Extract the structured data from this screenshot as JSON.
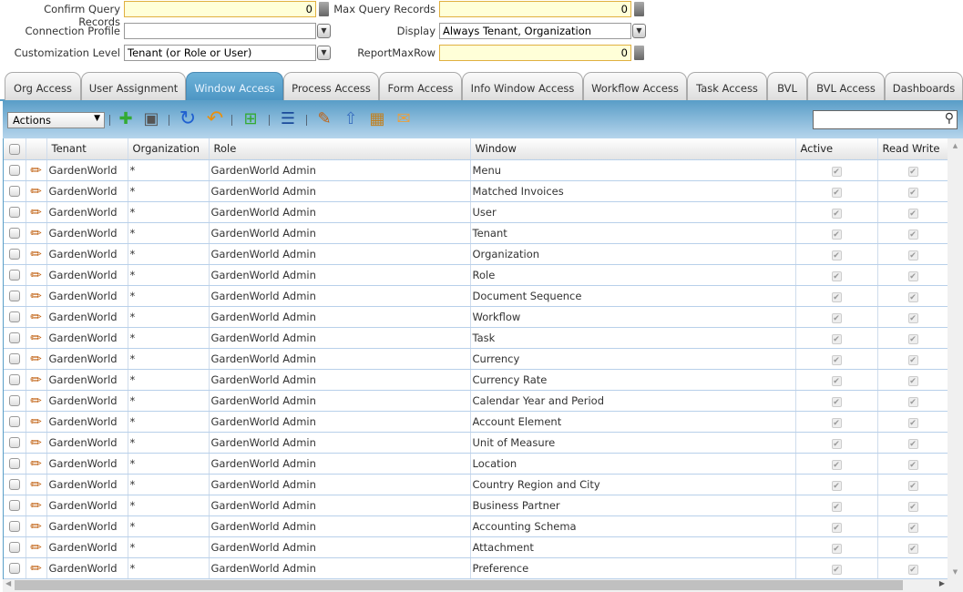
{
  "form": {
    "confirm_query_records": {
      "label": "Confirm Query Records",
      "value": "0"
    },
    "max_query_records": {
      "label": "Max Query Records",
      "value": "0"
    },
    "connection_profile": {
      "label": "Connection Profile",
      "value": ""
    },
    "display": {
      "label": "Display",
      "value": "Always Tenant, Organization"
    },
    "customization_level": {
      "label": "Customization Level",
      "value": "Tenant (or Role or User)"
    },
    "report_max_row": {
      "label": "ReportMaxRow",
      "value": "0"
    }
  },
  "tabs": [
    {
      "label": "Org Access"
    },
    {
      "label": "User Assignment"
    },
    {
      "label": "Window Access",
      "selected": true
    },
    {
      "label": "Process Access"
    },
    {
      "label": "Form Access"
    },
    {
      "label": "Info Window Access"
    },
    {
      "label": "Workflow Access"
    },
    {
      "label": "Task Access"
    },
    {
      "label": "BVL"
    },
    {
      "label": "BVL Access"
    },
    {
      "label": "Dashboards"
    }
  ],
  "toolbar": {
    "actions_label": "Actions",
    "icons": [
      "new-record-icon",
      "save-icon",
      "refresh-icon",
      "undo-icon",
      "new-row-icon",
      "grid-toggle-icon",
      "edit-icon",
      "export-icon",
      "report-icon",
      "email-icon",
      "search-icon"
    ],
    "search_value": ""
  },
  "grid": {
    "columns": [
      "Tenant",
      "Organization",
      "Role",
      "Window",
      "Active",
      "Read Write"
    ],
    "rows": [
      {
        "tenant": "GardenWorld",
        "org": "*",
        "role": "GardenWorld Admin",
        "window": "Menu",
        "active": true,
        "read_write": true
      },
      {
        "tenant": "GardenWorld",
        "org": "*",
        "role": "GardenWorld Admin",
        "window": "Matched Invoices",
        "active": true,
        "read_write": true
      },
      {
        "tenant": "GardenWorld",
        "org": "*",
        "role": "GardenWorld Admin",
        "window": "User",
        "active": true,
        "read_write": true
      },
      {
        "tenant": "GardenWorld",
        "org": "*",
        "role": "GardenWorld Admin",
        "window": "Tenant",
        "active": true,
        "read_write": true
      },
      {
        "tenant": "GardenWorld",
        "org": "*",
        "role": "GardenWorld Admin",
        "window": "Organization",
        "active": true,
        "read_write": true
      },
      {
        "tenant": "GardenWorld",
        "org": "*",
        "role": "GardenWorld Admin",
        "window": "Role",
        "active": true,
        "read_write": true
      },
      {
        "tenant": "GardenWorld",
        "org": "*",
        "role": "GardenWorld Admin",
        "window": "Document Sequence",
        "active": true,
        "read_write": true
      },
      {
        "tenant": "GardenWorld",
        "org": "*",
        "role": "GardenWorld Admin",
        "window": "Workflow",
        "active": true,
        "read_write": true
      },
      {
        "tenant": "GardenWorld",
        "org": "*",
        "role": "GardenWorld Admin",
        "window": "Task",
        "active": true,
        "read_write": true
      },
      {
        "tenant": "GardenWorld",
        "org": "*",
        "role": "GardenWorld Admin",
        "window": "Currency",
        "active": true,
        "read_write": true
      },
      {
        "tenant": "GardenWorld",
        "org": "*",
        "role": "GardenWorld Admin",
        "window": "Currency Rate",
        "active": true,
        "read_write": true
      },
      {
        "tenant": "GardenWorld",
        "org": "*",
        "role": "GardenWorld Admin",
        "window": "Calendar Year and Period",
        "active": true,
        "read_write": true
      },
      {
        "tenant": "GardenWorld",
        "org": "*",
        "role": "GardenWorld Admin",
        "window": "Account Element",
        "active": true,
        "read_write": true
      },
      {
        "tenant": "GardenWorld",
        "org": "*",
        "role": "GardenWorld Admin",
        "window": "Unit of Measure",
        "active": true,
        "read_write": true
      },
      {
        "tenant": "GardenWorld",
        "org": "*",
        "role": "GardenWorld Admin",
        "window": "Location",
        "active": true,
        "read_write": true
      },
      {
        "tenant": "GardenWorld",
        "org": "*",
        "role": "GardenWorld Admin",
        "window": "Country Region and City",
        "active": true,
        "read_write": true
      },
      {
        "tenant": "GardenWorld",
        "org": "*",
        "role": "GardenWorld Admin",
        "window": "Business Partner",
        "active": true,
        "read_write": true
      },
      {
        "tenant": "GardenWorld",
        "org": "*",
        "role": "GardenWorld Admin",
        "window": "Accounting Schema",
        "active": true,
        "read_write": true
      },
      {
        "tenant": "GardenWorld",
        "org": "*",
        "role": "GardenWorld Admin",
        "window": "Attachment",
        "active": true,
        "read_write": true
      },
      {
        "tenant": "GardenWorld",
        "org": "*",
        "role": "GardenWorld Admin",
        "window": "Preference",
        "active": true,
        "read_write": true
      }
    ]
  },
  "colors": {
    "accent": "#4d96c4",
    "required_field": "#ffffd8"
  }
}
